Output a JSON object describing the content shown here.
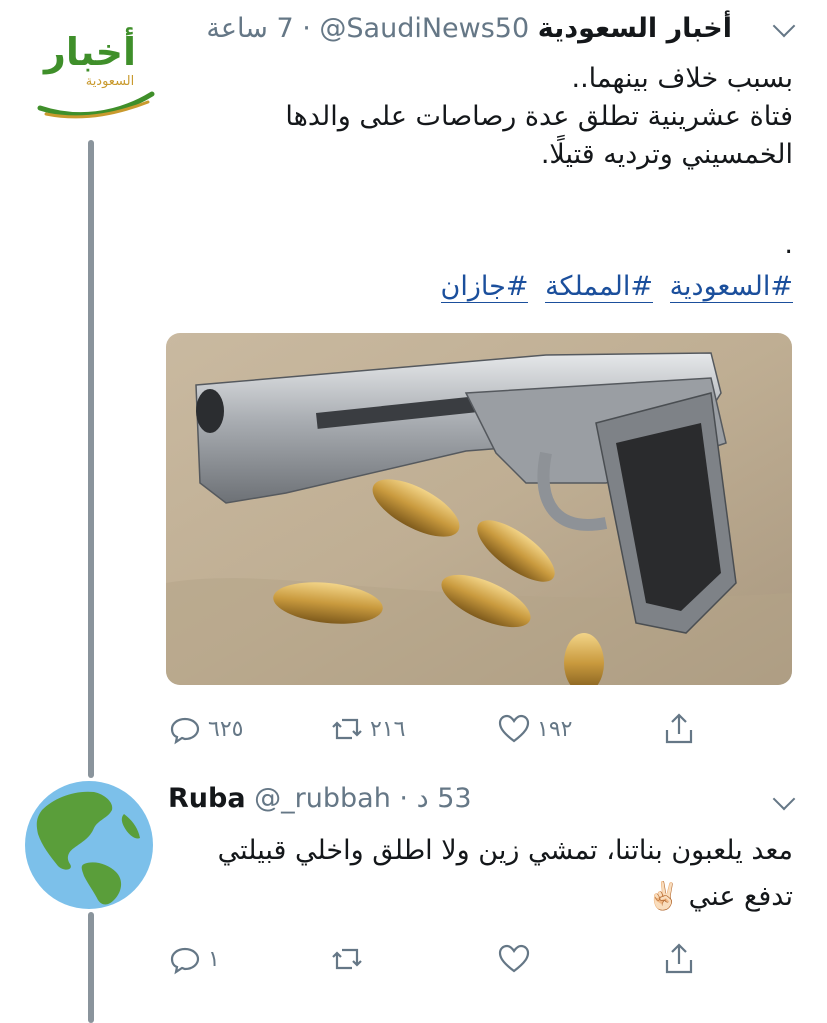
{
  "tweet1": {
    "display_name": "أخبار السعودية",
    "handle": "@SaudiNews50",
    "time": "7 ساعة",
    "text_lines": [
      "بسبب خلاف بينهما..",
      "فتاة عشرينية تطلق عدة رصاصات على والدها",
      "الخمسيني وترديه قتيلًا."
    ],
    "dot": ".",
    "hashtags": [
      "#السعودية",
      "#المملكة",
      "#جازان"
    ],
    "avatar_logo_text": "أخبار",
    "avatar_logo_sub": "السعودية",
    "actions": {
      "replies": "٦٢٥",
      "retweets": "٢١٦",
      "likes": "١٩٢"
    }
  },
  "tweet2": {
    "display_name": "Ruba",
    "handle": "@_rubbah",
    "time": "53 د",
    "text_lines": [
      "معد يلعبون بناتنا، تمشي زين ولا اطلق واخلي قبيلتي",
      "تدفع عني ✌🏻"
    ],
    "actions": {
      "replies": "١",
      "retweets": "",
      "likes": ""
    }
  },
  "colors": {
    "link": "#1b4f9c",
    "muted": "#657786",
    "thread": "#8a949c",
    "logo_green": "#3f8f2a",
    "logo_gold": "#c99a2e"
  }
}
